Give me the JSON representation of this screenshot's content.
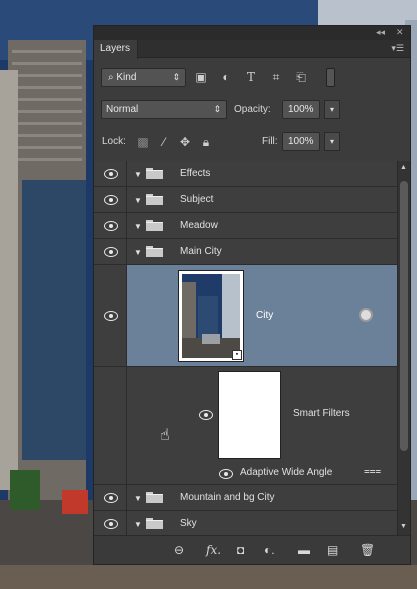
{
  "panel": {
    "tab_label": "Layers",
    "collapse_icon": "double-chevron-icon",
    "close_icon": "close-icon",
    "menu_icon": "panel-menu-icon"
  },
  "filter": {
    "kind_label": "Kind",
    "icons": [
      "image-filter-icon",
      "adjustment-filter-icon",
      "type-filter-icon",
      "shape-filter-icon",
      "smart-object-filter-icon"
    ]
  },
  "blend": {
    "mode": "Normal",
    "opacity_label": "Opacity:",
    "opacity_value": "100%"
  },
  "lock": {
    "label": "Lock:",
    "fill_label": "Fill:",
    "fill_value": "100%"
  },
  "layers": [
    {
      "name": "Effects",
      "type": "group",
      "visible": true
    },
    {
      "name": "Subject",
      "type": "group",
      "visible": true
    },
    {
      "name": "Meadow",
      "type": "group",
      "visible": true
    },
    {
      "name": "Main City",
      "type": "group",
      "visible": true,
      "expanded": true
    },
    {
      "name": "City",
      "type": "smart-object",
      "visible": true,
      "selected": true
    },
    {
      "name": "Smart Filters",
      "type": "smart-filters",
      "visible": true
    },
    {
      "name": "Adaptive Wide Angle",
      "type": "filter",
      "visible": true
    },
    {
      "name": "Mountain and bg City",
      "type": "group",
      "visible": true
    },
    {
      "name": "Sky",
      "type": "group",
      "visible": true
    }
  ],
  "bottom_bar": {
    "fx_label": "fx"
  },
  "colors": {
    "panel_bg": "#3c3c3c",
    "selected_row": "#6b8199"
  }
}
